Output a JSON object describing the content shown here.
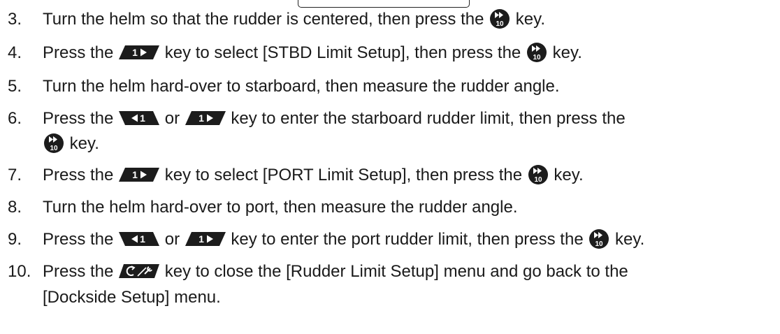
{
  "steps": [
    {
      "num": "3.",
      "parts": [
        {
          "t": "text",
          "v": "Turn the helm so that the rudder is centered, then press the "
        },
        {
          "t": "key",
          "k": "ff10"
        },
        {
          "t": "text",
          "v": " key."
        }
      ]
    },
    {
      "num": "4.",
      "parts": [
        {
          "t": "text",
          "v": "Press the "
        },
        {
          "t": "key",
          "k": "right1"
        },
        {
          "t": "text",
          "v": " key to select [STBD Limit Setup], then press the "
        },
        {
          "t": "key",
          "k": "ff10"
        },
        {
          "t": "text",
          "v": " key."
        }
      ]
    },
    {
      "num": "5.",
      "parts": [
        {
          "t": "text",
          "v": "Turn the helm hard-over to starboard, then measure the rudder angle."
        }
      ]
    },
    {
      "num": "6.",
      "parts": [
        {
          "t": "text",
          "v": "Press the "
        },
        {
          "t": "key",
          "k": "left1"
        },
        {
          "t": "text",
          "v": " or "
        },
        {
          "t": "key",
          "k": "right1"
        },
        {
          "t": "text",
          "v": " key to enter the starboard rudder limit, then press the"
        }
      ]
    },
    {
      "num": "",
      "parts": [
        {
          "t": "key",
          "k": "ff10"
        },
        {
          "t": "text",
          "v": " key."
        }
      ]
    },
    {
      "num": "7.",
      "parts": [
        {
          "t": "text",
          "v": "Press the "
        },
        {
          "t": "key",
          "k": "right1"
        },
        {
          "t": "text",
          "v": " key to select [PORT Limit Setup], then press the "
        },
        {
          "t": "key",
          "k": "ff10"
        },
        {
          "t": "text",
          "v": " key."
        }
      ]
    },
    {
      "num": "8.",
      "parts": [
        {
          "t": "text",
          "v": "Turn the helm hard-over to port, then measure the rudder angle."
        }
      ]
    },
    {
      "num": "9.",
      "parts": [
        {
          "t": "text",
          "v": "Press the "
        },
        {
          "t": "key",
          "k": "left1"
        },
        {
          "t": "text",
          "v": " or "
        },
        {
          "t": "key",
          "k": "right1"
        },
        {
          "t": "text",
          "v": " key to enter the port rudder limit, then press the "
        },
        {
          "t": "key",
          "k": "ff10"
        },
        {
          "t": "text",
          "v": " key."
        }
      ]
    },
    {
      "num": "10.",
      "parts": [
        {
          "t": "text",
          "v": "Press the "
        },
        {
          "t": "key",
          "k": "cancel"
        },
        {
          "t": "text",
          "v": " key to close the [Rudder Limit Setup] menu and go back to the"
        }
      ]
    },
    {
      "num": "",
      "parts": [
        {
          "t": "text",
          "v": "[Dockside Setup] menu."
        }
      ]
    }
  ],
  "keys": {
    "ff10": {
      "icon": "fast-forward-10-icon",
      "label": "10"
    },
    "right1": {
      "icon": "right-1-key-icon",
      "label": "1"
    },
    "left1": {
      "icon": "left-1-key-icon",
      "label": "1"
    },
    "cancel": {
      "icon": "cancel-wrench-key-icon"
    }
  },
  "colors": {
    "key_fill": "#1c1c1c",
    "text": "#1a1a1a"
  }
}
